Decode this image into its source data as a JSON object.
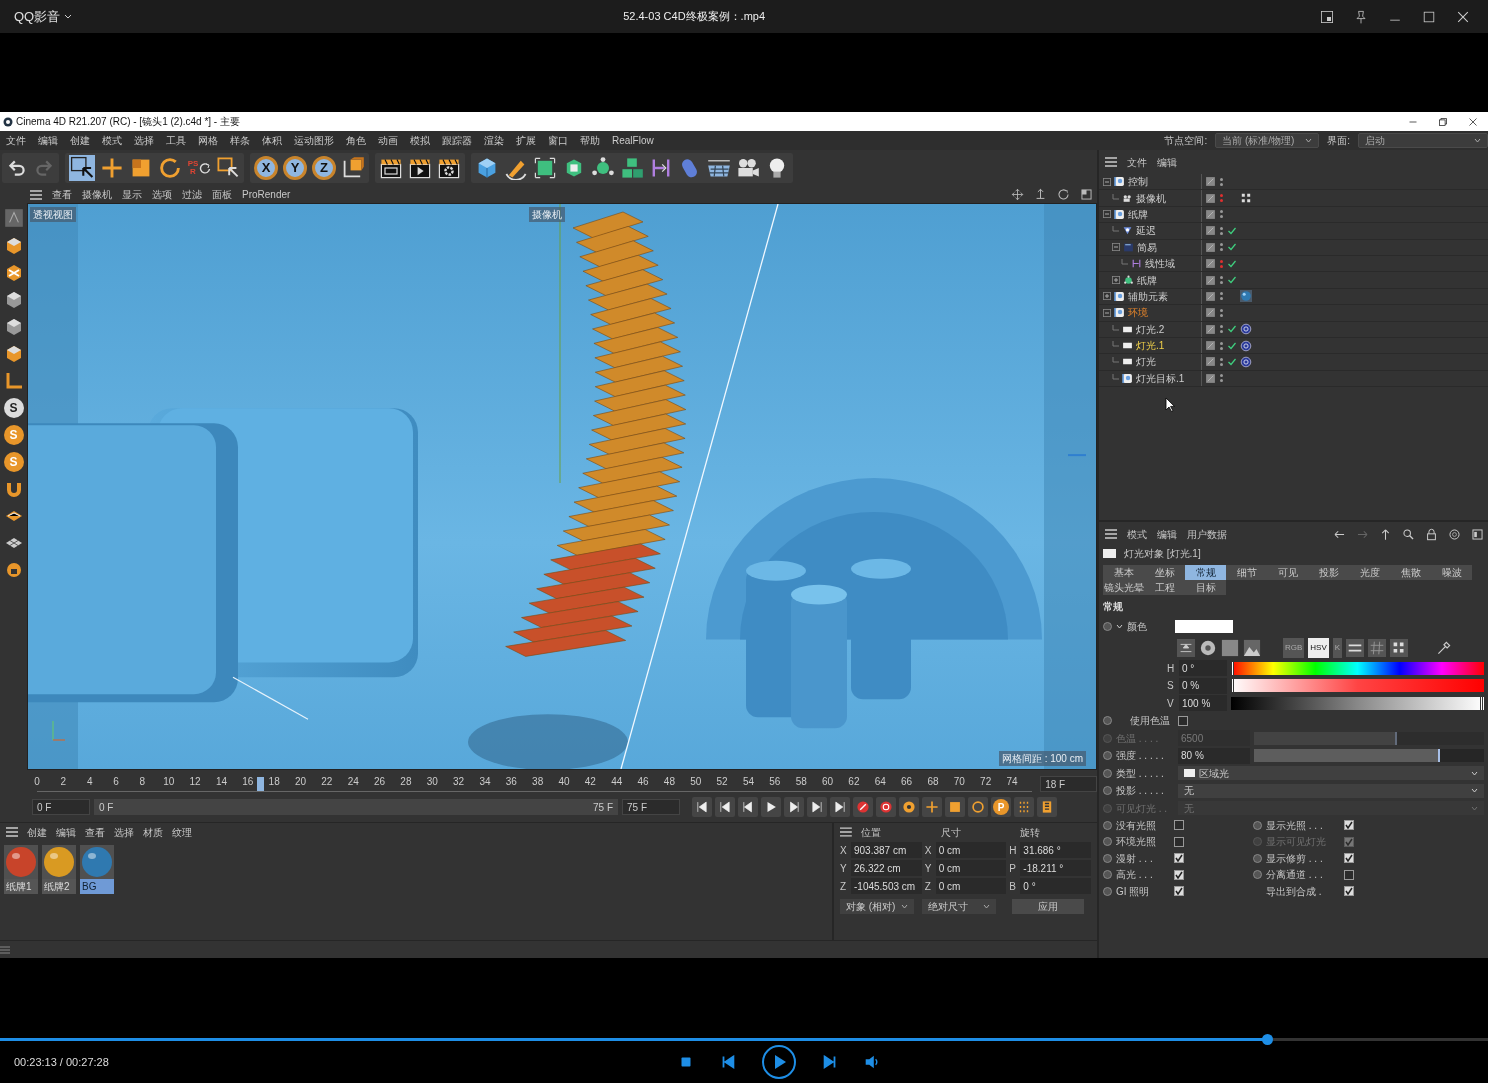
{
  "player": {
    "app_name": "QQ影音",
    "title": "52.4-03 C4D终极案例：.mp4",
    "progress": {
      "level": 0.852
    },
    "time": "00:23:13 / 00:27:28",
    "playing": false
  },
  "c4d": {
    "title": "Cinema 4D R21.207 (RC) - [镜头1 (2).c4d *] - 主要",
    "menus": [
      "文件",
      "编辑",
      "创建",
      "模式",
      "选择",
      "工具",
      "网格",
      "样条",
      "体积",
      "运动图形",
      "角色",
      "动画",
      "模拟",
      "跟踪器",
      "渲染",
      "扩展",
      "窗口",
      "帮助",
      "RealFlow"
    ],
    "node_space": {
      "label": "节点空间:",
      "value": "当前 (标准/物理)"
    },
    "layout": {
      "label": "界面:",
      "value": "启动"
    },
    "toolbar": {
      "psr": "PSR",
      "axes": [
        {
          "label": "X",
          "on": true
        },
        {
          "label": "Y",
          "on": true
        },
        {
          "label": "Z",
          "on": true
        }
      ]
    },
    "left_tools": [
      "S",
      "S",
      "S"
    ],
    "viewport": {
      "menus": [
        "查看",
        "摄像机",
        "显示",
        "选项",
        "过滤",
        "面板",
        "ProRender"
      ],
      "view_name": "透视视图",
      "camera_label": "摄像机",
      "grid_spacing": "网格间距 : 100 cm"
    },
    "timeline": {
      "ticks": [
        "0",
        "2",
        "4",
        "6",
        "8",
        "10",
        "12",
        "14",
        "16",
        "18",
        "20",
        "22",
        "24",
        "26",
        "28",
        "30",
        "32",
        "34",
        "36",
        "38",
        "40",
        "42",
        "44",
        "46",
        "48",
        "50",
        "52",
        "54",
        "56",
        "58",
        "60",
        "62",
        "64",
        "66",
        "68",
        "70",
        "72",
        "74"
      ],
      "playhead": {
        "level": 0.24
      },
      "current_frame": "18 F",
      "start": "0 F",
      "range_start": "0 F",
      "range_end": "75 F",
      "end": "75 F",
      "key_letter": "P"
    },
    "materials": {
      "menus": [
        "创建",
        "编辑",
        "查看",
        "选择",
        "材质",
        "纹理"
      ],
      "items": [
        {
          "name": "纸牌1",
          "color": "#c8442a",
          "selected": false
        },
        {
          "name": "纸牌2",
          "color": "#d99a22",
          "selected": false
        },
        {
          "name": "BG",
          "color": "#2f79b0",
          "selected": true
        }
      ]
    },
    "coordinates": {
      "headers": [
        "位置",
        "尺寸",
        "旋转"
      ],
      "rows": [
        [
          {
            "axis": "X",
            "value": "903.387 cm"
          },
          {
            "axis": "X",
            "value": "0 cm"
          },
          {
            "axis": "H",
            "value": "31.686 °"
          }
        ],
        [
          {
            "axis": "Y",
            "value": "26.322 cm"
          },
          {
            "axis": "Y",
            "value": "0 cm"
          },
          {
            "axis": "P",
            "value": "-18.211 °"
          }
        ],
        [
          {
            "axis": "Z",
            "value": "-1045.503 cm"
          },
          {
            "axis": "Z",
            "value": "0 cm"
          },
          {
            "axis": "B",
            "value": "0 °"
          }
        ]
      ],
      "mode": "对象 (相对)",
      "size_mode": "绝对尺寸",
      "apply": "应用"
    },
    "objects": {
      "menus": [
        "文件",
        "编辑"
      ],
      "tree": [
        {
          "name": "控制",
          "kind": "null",
          "expanded": true,
          "selected": false,
          "highlighted": false,
          "check": false,
          "visible_off": false,
          "children": [
            {
              "name": "摄像机",
              "kind": "camera",
              "selected": false,
              "highlighted": false,
              "check": false,
              "visible_off": true,
              "tags": [
                {
                  "kind": "protect"
                }
              ]
            }
          ]
        },
        {
          "name": "纸牌",
          "kind": "null",
          "expanded": true,
          "selected": false,
          "highlighted": false,
          "check": false,
          "visible_off": false,
          "children": [
            {
              "name": "延迟",
              "kind": "effector",
              "selected": false,
              "highlighted": false,
              "check": true,
              "visible_off": false
            },
            {
              "name": "简易",
              "kind": "plain",
              "expanded": true,
              "selected": false,
              "highlighted": false,
              "check": true,
              "visible_off": false,
              "children": [
                {
                  "name": "线性域",
                  "kind": "field",
                  "selected": false,
                  "highlighted": false,
                  "check": true,
                  "visible_off": true
                }
              ]
            },
            {
              "name": "纸牌",
              "kind": "cloner",
              "expanded": false,
              "selected": false,
              "highlighted": false,
              "check": true,
              "visible_off": false
            }
          ]
        },
        {
          "name": "辅助元素",
          "kind": "null",
          "expanded": false,
          "selected": false,
          "highlighted": false,
          "check": false,
          "visible_off": false,
          "tags": [
            {
              "kind": "material"
            }
          ]
        },
        {
          "name": "环境",
          "kind": "null",
          "expanded": true,
          "selected": false,
          "highlighted": true,
          "check": false,
          "visible_off": false,
          "children": [
            {
              "name": "灯光.2",
              "kind": "light",
              "selected": false,
              "highlighted": false,
              "check": true,
              "visible_off": false,
              "tags": [
                {
                  "kind": "target"
                }
              ]
            },
            {
              "name": "灯光.1",
              "kind": "light",
              "selected": true,
              "highlighted": false,
              "check": true,
              "visible_off": false,
              "tags": [
                {
                  "kind": "target"
                }
              ]
            },
            {
              "name": "灯光",
              "kind": "light",
              "selected": false,
              "highlighted": false,
              "check": true,
              "visible_off": false,
              "tags": [
                {
                  "kind": "target"
                }
              ]
            },
            {
              "name": "灯光目标.1",
              "kind": "null",
              "selected": false,
              "highlighted": false,
              "check": false,
              "visible_off": false
            }
          ]
        }
      ]
    },
    "attributes": {
      "menus": [
        "模式",
        "编辑",
        "用户数据"
      ],
      "object": "灯光对象 [灯光.1]",
      "tabs": [
        {
          "label": "基本",
          "selected": false
        },
        {
          "label": "坐标",
          "selected": false
        },
        {
          "label": "常规",
          "selected": true
        },
        {
          "label": "细节",
          "selected": false
        },
        {
          "label": "可见",
          "selected": false
        },
        {
          "label": "投影",
          "selected": false
        },
        {
          "label": "光度",
          "selected": false
        },
        {
          "label": "焦散",
          "selected": false
        },
        {
          "label": "噪波",
          "selected": false
        },
        {
          "label": "镜头光晕",
          "selected": false
        },
        {
          "label": "工程",
          "selected": false
        },
        {
          "label": "目标",
          "selected": false
        }
      ],
      "section": "常规",
      "color": {
        "label": "颜色",
        "color": "#ffffff",
        "modes": [
          {
            "label": "RGB",
            "selected": false
          },
          {
            "label": "HSV",
            "selected": true
          },
          {
            "label": "K",
            "selected": false
          }
        ]
      },
      "hsv": [
        {
          "axis": "H",
          "value": "0 °",
          "level": 0
        },
        {
          "axis": "S",
          "value": "0 %",
          "level": 0
        },
        {
          "axis": "V",
          "value": "100 %",
          "level": 1
        }
      ],
      "fields": [
        {
          "kind": "checkbox",
          "label": "使用色温",
          "checked": false,
          "disabled": false
        },
        {
          "kind": "slider",
          "label": "色温 . . . .",
          "value": "6500",
          "level": 0.62,
          "disabled": true
        },
        {
          "kind": "slider",
          "label": "强度 . . . . .",
          "value": "80 %",
          "level": 0.81,
          "disabled": false
        },
        {
          "kind": "select",
          "label": "类型 . . . . .",
          "value": "区域光",
          "disabled": false
        },
        {
          "kind": "select",
          "label": "投影 . . . . .",
          "value": "无",
          "disabled": false
        },
        {
          "kind": "select",
          "label": "可见灯光 . .",
          "value": "无",
          "disabled": true
        }
      ],
      "flags": [
        {
          "label": "没有光照",
          "checked": false,
          "disabled": false,
          "keyframe": true
        },
        {
          "label": "显示光照 . . .",
          "checked": true,
          "disabled": false,
          "keyframe": true
        },
        {
          "label": "环境光照",
          "checked": false,
          "disabled": false,
          "keyframe": true
        },
        {
          "label": "显示可见灯光",
          "checked": true,
          "disabled": true,
          "keyframe": true
        },
        {
          "label": "漫射 . . .",
          "checked": true,
          "disabled": false,
          "keyframe": true
        },
        {
          "label": "显示修剪 . . .",
          "checked": true,
          "disabled": false,
          "keyframe": true
        },
        {
          "label": "高光 . . .",
          "checked": true,
          "disabled": false,
          "keyframe": true
        },
        {
          "label": "分离通道 . . .",
          "checked": false,
          "disabled": false,
          "keyframe": true
        },
        {
          "label": "GI 照明",
          "checked": true,
          "disabled": false,
          "keyframe": true
        },
        {
          "label": "导出到合成 .",
          "checked": true,
          "disabled": false,
          "keyframe": false
        }
      ]
    }
  }
}
